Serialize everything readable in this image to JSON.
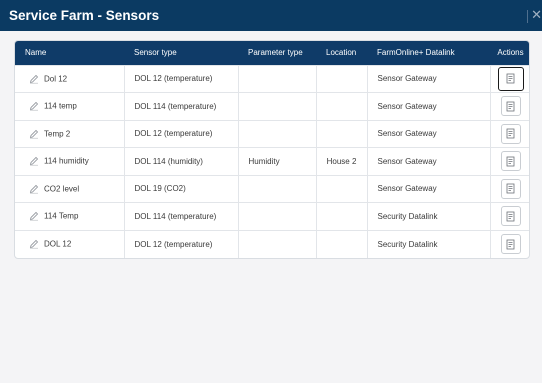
{
  "header": {
    "title": "Service Farm - Sensors"
  },
  "table": {
    "columns": [
      "Name",
      "Sensor type",
      "Parameter type",
      "Location",
      "FarmOnline+ Datalink",
      "Actions"
    ],
    "rows": [
      {
        "name": "Dol 12",
        "sensor_type": "DOL 12 (temperature)",
        "parameter_type": "",
        "location": "",
        "datalink": "Sensor Gateway"
      },
      {
        "name": "114 temp",
        "sensor_type": "DOL 114 (temperature)",
        "parameter_type": "",
        "location": "",
        "datalink": "Sensor Gateway"
      },
      {
        "name": "Temp 2",
        "sensor_type": "DOL 12 (temperature)",
        "parameter_type": "",
        "location": "",
        "datalink": "Sensor Gateway"
      },
      {
        "name": "114 humidity",
        "sensor_type": "DOL 114 (humidity)",
        "parameter_type": "Humidity",
        "location": "House 2",
        "datalink": "Sensor Gateway"
      },
      {
        "name": "CO2 level",
        "sensor_type": "DOL 19 (CO2)",
        "parameter_type": "",
        "location": "",
        "datalink": "Sensor Gateway"
      },
      {
        "name": "114 Temp",
        "sensor_type": "DOL 114 (temperature)",
        "parameter_type": "",
        "location": "",
        "datalink": "Security Datalink"
      },
      {
        "name": "DOL 12",
        "sensor_type": "DOL 12 (temperature)",
        "parameter_type": "",
        "location": "",
        "datalink": "Security Datalink"
      }
    ]
  },
  "colors": {
    "header_bg": "#0b3a62",
    "table_header_bg": "#0f3b68"
  },
  "icons": {
    "edit": "pencil-icon",
    "action": "document-icon",
    "close": "close-icon"
  }
}
